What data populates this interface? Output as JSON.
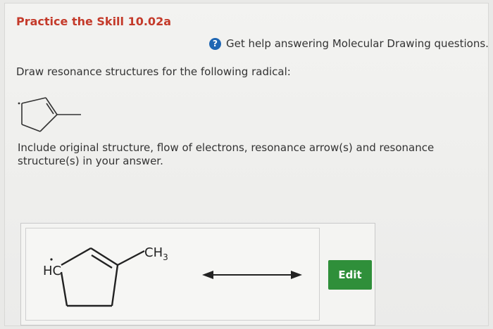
{
  "header": {
    "title": "Practice the Skill 10.02a"
  },
  "help": {
    "icon": "question-circle-icon",
    "icon_glyph": "?",
    "text": "Get help answering Molecular Drawing questions."
  },
  "question": {
    "prompt": "Draw resonance structures for the following radical:",
    "instructions": "Include original structure, flow of electrons, resonance arrow(s) and resonance structure(s) in your answer."
  },
  "answer": {
    "label_hc": "HC",
    "label_ch": "CH",
    "label_sub": "3",
    "edit_label": "Edit"
  },
  "colors": {
    "title": "#c43a2a",
    "help_icon": "#1f66b3",
    "edit_button": "#2f8f3a"
  }
}
